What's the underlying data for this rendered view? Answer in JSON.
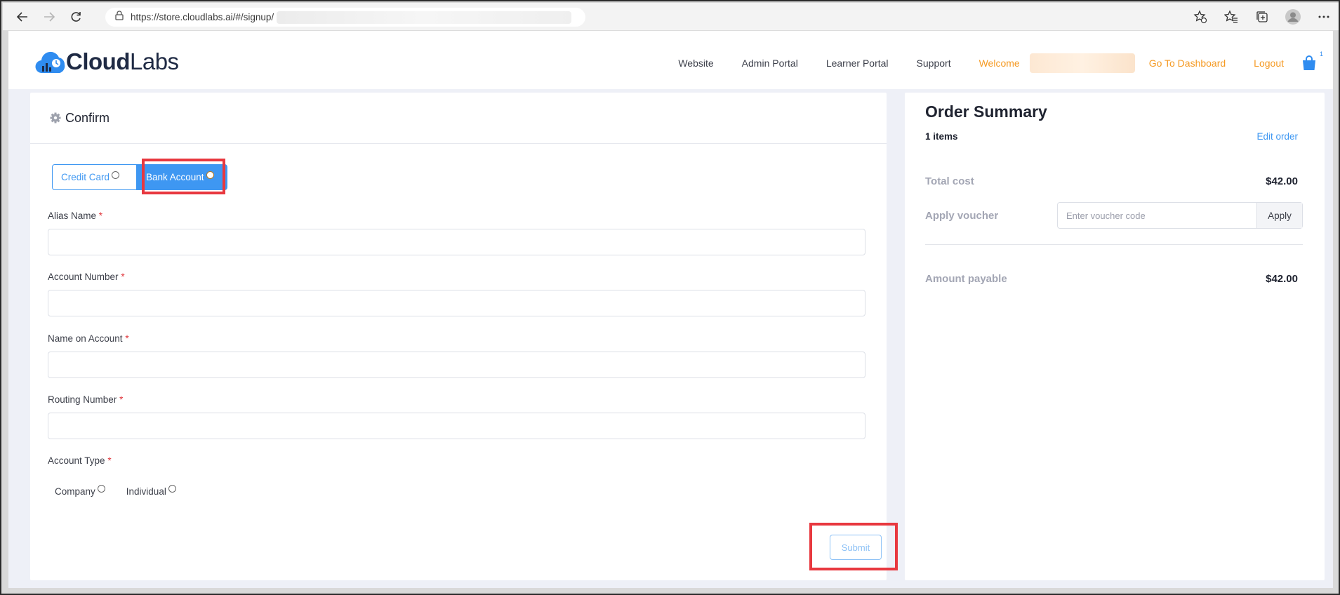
{
  "browser": {
    "url": "https://store.cloudlabs.ai/#/signup/"
  },
  "header": {
    "logo_bold": "Cloud",
    "logo_light": "Labs",
    "nav": {
      "website": "Website",
      "admin_portal": "Admin Portal",
      "learner_portal": "Learner Portal",
      "support": "Support",
      "welcome": "Welcome",
      "dashboard": "Go To Dashboard",
      "logout": "Logout"
    },
    "cart_count": "1"
  },
  "payment": {
    "title": "Confirm",
    "methods": {
      "credit_card": "Credit Card",
      "bank_account": "Bank Account"
    },
    "selected_method": "Bank Account",
    "fields": {
      "alias_name": "Alias Name",
      "account_number": "Account Number",
      "name_on_account": "Name on Account",
      "routing_number": "Routing Number",
      "account_type": "Account Type"
    },
    "required_mark": "*",
    "account_types": {
      "company": "Company",
      "individual": "Individual"
    },
    "submit_label": "Submit"
  },
  "order_summary": {
    "title": "Order Summary",
    "items": "1 items",
    "edit_order": "Edit order",
    "total_cost_label": "Total cost",
    "total_cost_value": "$42.00",
    "apply_voucher_label": "Apply voucher",
    "voucher_placeholder": "Enter voucher code",
    "apply_button": "Apply",
    "amount_payable_label": "Amount payable",
    "amount_payable_value": "$42.00"
  },
  "colors": {
    "accent_blue": "#3e97f2",
    "accent_orange": "#f59a23",
    "highlight_red": "#e8383f"
  }
}
